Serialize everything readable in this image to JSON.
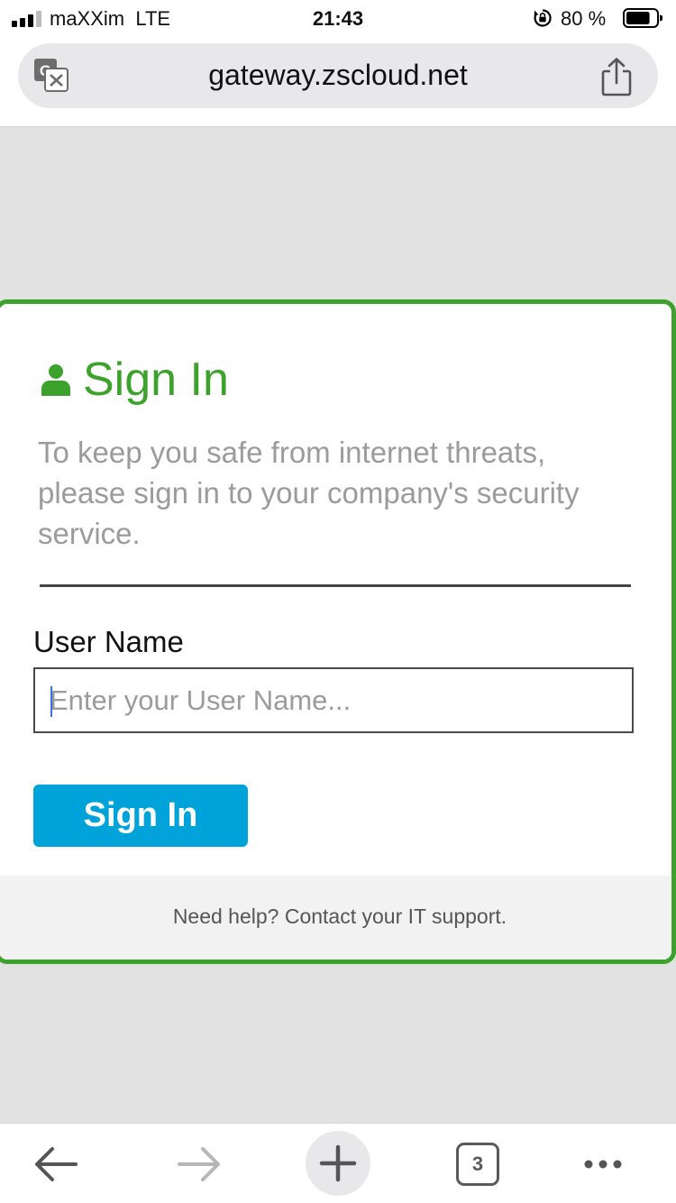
{
  "status_bar": {
    "carrier": "maXXim",
    "network": "LTE",
    "time": "21:43",
    "battery_percent": "80 %",
    "signal_bars_active": 3,
    "signal_bars_total": 4,
    "battery_level": 0.8
  },
  "browser": {
    "url": "gateway.zscloud.net",
    "open_tabs": "3"
  },
  "signin": {
    "title": "Sign In",
    "intro": "To keep you safe from internet threats, please sign in to your company's security service.",
    "username_label": "User Name",
    "username_placeholder": "Enter your User Name...",
    "username_value": "",
    "submit_label": "Sign In",
    "help_text": "Need help? Contact your IT support."
  },
  "colors": {
    "brand_green": "#3da22b",
    "button_blue": "#00a3d9",
    "page_background": "#e2e2e2"
  },
  "icons": {
    "translate": "translate-icon",
    "share": "share-icon",
    "user": "user-icon",
    "back": "back-arrow-icon",
    "forward": "forward-arrow-icon",
    "new_tab": "plus-icon",
    "tabs": "tabs-icon",
    "more": "more-dots-icon"
  }
}
